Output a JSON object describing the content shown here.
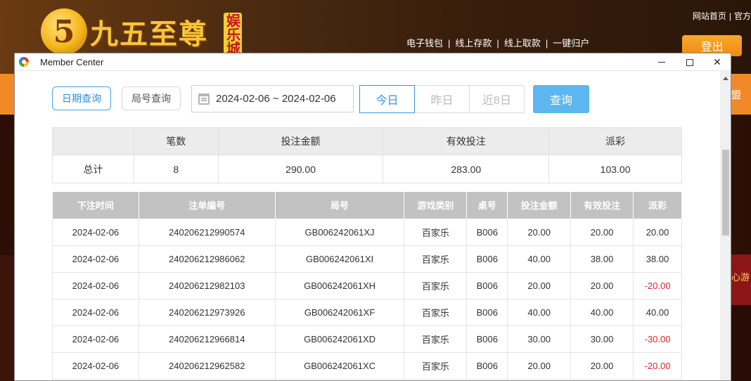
{
  "site": {
    "logo_glyph": "5",
    "logo_text": "九五至尊",
    "logo_badge": "娱乐城",
    "top_links": [
      "网站首页",
      "官方"
    ],
    "nav_links": [
      "电子钱包",
      "线上存款",
      "线上取款",
      "一键归户"
    ],
    "logout_label": "登出",
    "right_edge_text_1": "盟",
    "right_edge_text_2": "心游"
  },
  "window": {
    "title": "Member Center"
  },
  "controls": {
    "tab_date": "日期查询",
    "tab_round": "局号查询",
    "date_range": "2024-02-06 ~ 2024-02-06",
    "quick": [
      "今日",
      "昨日",
      "近8日"
    ],
    "query": "查询"
  },
  "summary": {
    "headers": [
      "",
      "笔数",
      "投注金额",
      "有效投注",
      "派彩"
    ],
    "row": [
      "总计",
      "8",
      "290.00",
      "283.00",
      "103.00"
    ]
  },
  "detail": {
    "headers": [
      "下注时间",
      "注单编号",
      "局号",
      "游戏类别",
      "桌号",
      "投注金额",
      "有效投注",
      "派彩"
    ],
    "rows": [
      [
        "2024-02-06",
        "240206212990574",
        "GB006242061XJ",
        "百家乐",
        "B006",
        "20.00",
        "20.00",
        "20.00"
      ],
      [
        "2024-02-06",
        "240206212986062",
        "GB006242061XI",
        "百家乐",
        "B006",
        "40.00",
        "38.00",
        "38.00"
      ],
      [
        "2024-02-06",
        "240206212982103",
        "GB006242061XH",
        "百家乐",
        "B006",
        "20.00",
        "20.00",
        "-20.00"
      ],
      [
        "2024-02-06",
        "240206212973926",
        "GB006242061XF",
        "百家乐",
        "B006",
        "40.00",
        "40.00",
        "40.00"
      ],
      [
        "2024-02-06",
        "240206212966814",
        "GB006242061XD",
        "百家乐",
        "B006",
        "30.00",
        "30.00",
        "-30.00"
      ],
      [
        "2024-02-06",
        "240206212962582",
        "GB006242061XC",
        "百家乐",
        "B006",
        "20.00",
        "20.00",
        "-20.00"
      ]
    ]
  },
  "colors": {
    "accent": "#5cb7f0",
    "negative": "#e0242a",
    "header_gray": "#c2c2c2"
  }
}
